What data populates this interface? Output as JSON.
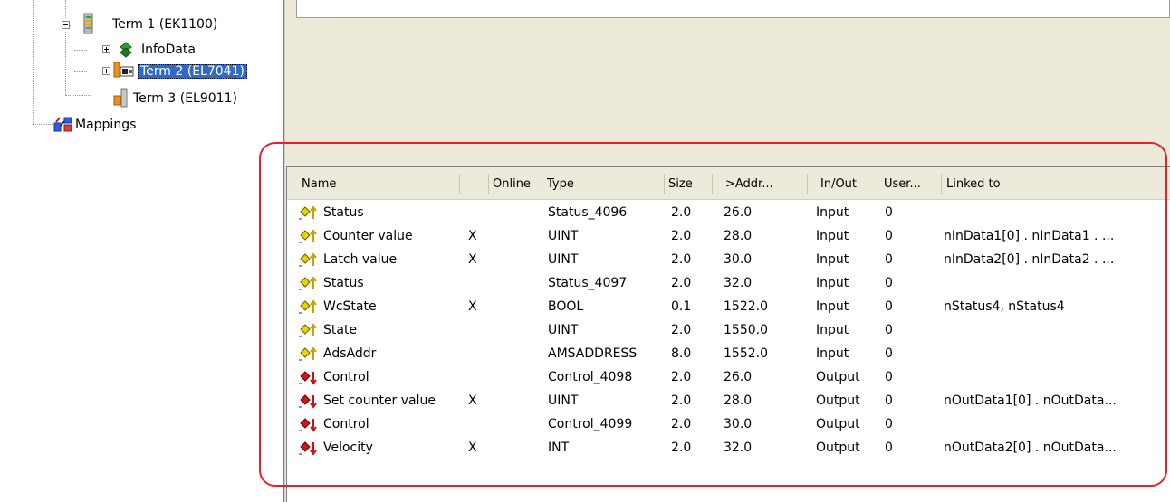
{
  "tree": {
    "items": [
      {
        "label": "Term 1 (EK1100)"
      },
      {
        "label": "InfoData"
      },
      {
        "label": "Term 2 (EL7041)"
      },
      {
        "label": "Term 3 (EL9011)"
      },
      {
        "label": "Mappings"
      }
    ]
  },
  "table": {
    "columns": [
      "Name",
      "Online",
      "Type",
      "Size",
      ">Addr...",
      "In/Out",
      "User...",
      "Linked to"
    ],
    "rows": [
      {
        "dir": "in",
        "name": "Status",
        "online": "",
        "type": "Status_4096",
        "size": "2.0",
        "addr": "26.0",
        "inout": "Input",
        "user": "0",
        "linked": ""
      },
      {
        "dir": "in",
        "name": "Counter value",
        "online": "X",
        "type": "UINT",
        "size": "2.0",
        "addr": "28.0",
        "inout": "Input",
        "user": "0",
        "linked": "nInData1[0] . nInData1 . ..."
      },
      {
        "dir": "in",
        "name": "Latch value",
        "online": "X",
        "type": "UINT",
        "size": "2.0",
        "addr": "30.0",
        "inout": "Input",
        "user": "0",
        "linked": "nInData2[0] . nInData2 . ..."
      },
      {
        "dir": "in",
        "name": "Status",
        "online": "",
        "type": "Status_4097",
        "size": "2.0",
        "addr": "32.0",
        "inout": "Input",
        "user": "0",
        "linked": ""
      },
      {
        "dir": "in",
        "name": "WcState",
        "online": "X",
        "type": "BOOL",
        "size": "0.1",
        "addr": "1522.0",
        "inout": "Input",
        "user": "0",
        "linked": "nStatus4, nStatus4"
      },
      {
        "dir": "in",
        "name": "State",
        "online": "",
        "type": "UINT",
        "size": "2.0",
        "addr": "1550.0",
        "inout": "Input",
        "user": "0",
        "linked": ""
      },
      {
        "dir": "in",
        "name": "AdsAddr",
        "online": "",
        "type": "AMSADDRESS",
        "size": "8.0",
        "addr": "1552.0",
        "inout": "Input",
        "user": "0",
        "linked": ""
      },
      {
        "dir": "out",
        "name": "Control",
        "online": "",
        "type": "Control_4098",
        "size": "2.0",
        "addr": "26.0",
        "inout": "Output",
        "user": "0",
        "linked": ""
      },
      {
        "dir": "out",
        "name": "Set counter value",
        "online": "X",
        "type": "UINT",
        "size": "2.0",
        "addr": "28.0",
        "inout": "Output",
        "user": "0",
        "linked": "nOutData1[0] . nOutData..."
      },
      {
        "dir": "out",
        "name": "Control",
        "online": "",
        "type": "Control_4099",
        "size": "2.0",
        "addr": "30.0",
        "inout": "Output",
        "user": "0",
        "linked": ""
      },
      {
        "dir": "out",
        "name": "Velocity",
        "online": "X",
        "type": "INT",
        "size": "2.0",
        "addr": "32.0",
        "inout": "Output",
        "user": "0",
        "linked": "nOutData2[0] . nOutData..."
      }
    ]
  },
  "colors": {
    "selection": "#316ac5",
    "highlight_outline": "#e8202a",
    "input_arrow": "#c8a000",
    "output_arrow": "#d01010",
    "variable_diamond_in": "#e8d200",
    "variable_diamond_out": "#c81818"
  },
  "icons": {
    "tree": [
      "ek1100-coupler-icon",
      "infodata-icon",
      "el7041-terminal-icon",
      "el9011-endcap-icon",
      "mappings-icon"
    ],
    "variable_in": "input-variable-icon",
    "variable_out": "output-variable-icon"
  }
}
